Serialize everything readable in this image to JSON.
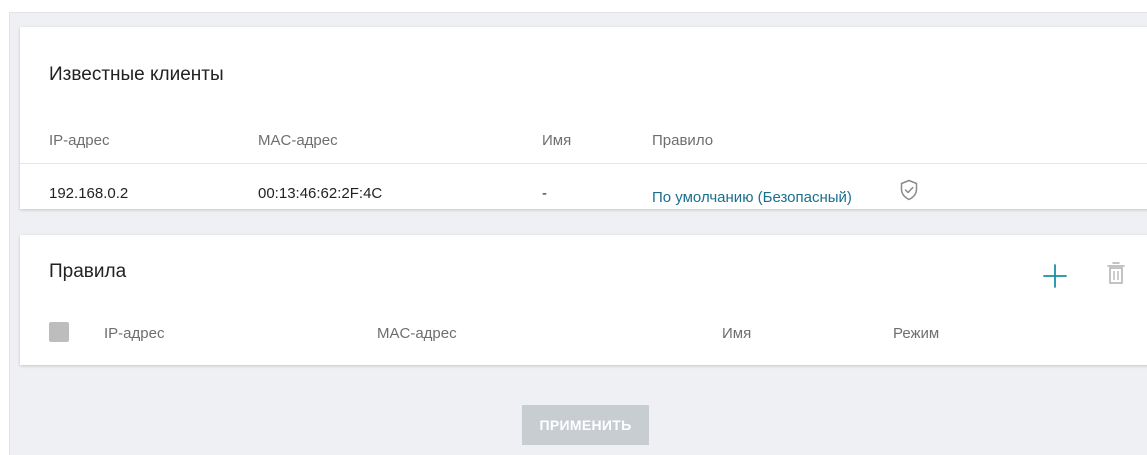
{
  "clients": {
    "title": "Известные клиенты",
    "columns": [
      "IP-адрес",
      "MAC-адрес",
      "Имя",
      "Правило"
    ],
    "rows": [
      {
        "ip": "192.168.0.2",
        "mac": "00:13:46:62:2F:4C",
        "name": "-",
        "rule": "По умолчанию (Безопасный)",
        "rule_icon": "shield-check-icon"
      }
    ]
  },
  "rules": {
    "title": "Правила",
    "columns": [
      "IP-адрес",
      "MAC-адрес",
      "Имя",
      "Режим"
    ],
    "actions": [
      {
        "icon": "plus-icon",
        "color": "#1a8fa6"
      },
      {
        "icon": "trash-icon",
        "color": "#b0b0b0"
      }
    ]
  },
  "footer": {
    "apply_label": "ПРИМЕНИТЬ"
  },
  "colors": {
    "accent": "#1a8fa6",
    "link": "#1a6f8f",
    "background": "#eef0f3",
    "disabled_button": "#c8cdd2"
  }
}
